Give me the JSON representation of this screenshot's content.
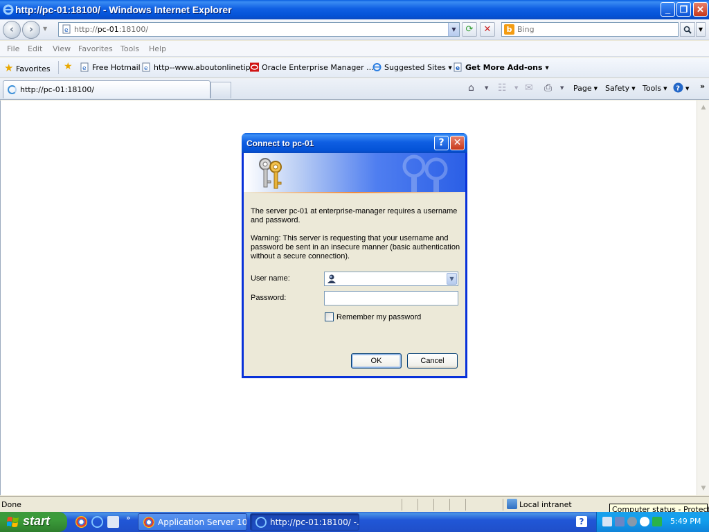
{
  "window": {
    "title": "http://pc-01:18100/ - Windows Internet Explorer",
    "min_glyph": "_",
    "max_glyph": "❐",
    "close_glyph": "✕"
  },
  "address_bar": {
    "url_prefix": "http://",
    "url_host": "pc-01",
    "url_rest": ":18100/",
    "search_placeholder": "Bing"
  },
  "menu": [
    "File",
    "Edit",
    "View",
    "Favorites",
    "Tools",
    "Help"
  ],
  "favorites_bar": {
    "favorites_label": "Favorites",
    "items": [
      "Free Hotmail",
      "http--www.aboutonlinetips",
      "Oracle Enterprise Manager ...",
      "Suggested Sites",
      "Get More Add-ons"
    ]
  },
  "tabs": {
    "active_label": "http://pc-01:18100/"
  },
  "command_bar": {
    "page": "Page",
    "safety": "Safety",
    "tools": "Tools",
    "more": "»"
  },
  "status_bar": {
    "status": "Done",
    "zone": "Local intranet",
    "tooltip": "Computer status - Protected"
  },
  "taskbar": {
    "start_label": "start",
    "tasks": [
      "Application Server 10...",
      "http://pc-01:18100/ -..."
    ],
    "quicklaunch_more": "»",
    "clock": "5:49 PM"
  },
  "dialog": {
    "title": "Connect to pc-01",
    "message": "The server pc-01 at enterprise-manager requires a username and password.",
    "warning": "Warning: This server is requesting that your username and password be sent in an insecure manner (basic authentication without a secure connection).",
    "username_label": "User name:",
    "password_label": "Password:",
    "username_value": "",
    "password_value": "",
    "remember_label": "Remember my password",
    "remember_checked": false,
    "ok_label": "OK",
    "cancel_label": "Cancel"
  },
  "colors": {
    "xp_blue": "#0453d7",
    "dialog_face": "#ece9d8",
    "start_green": "#3b9b3a",
    "tray_blue": "#12a0ee"
  }
}
